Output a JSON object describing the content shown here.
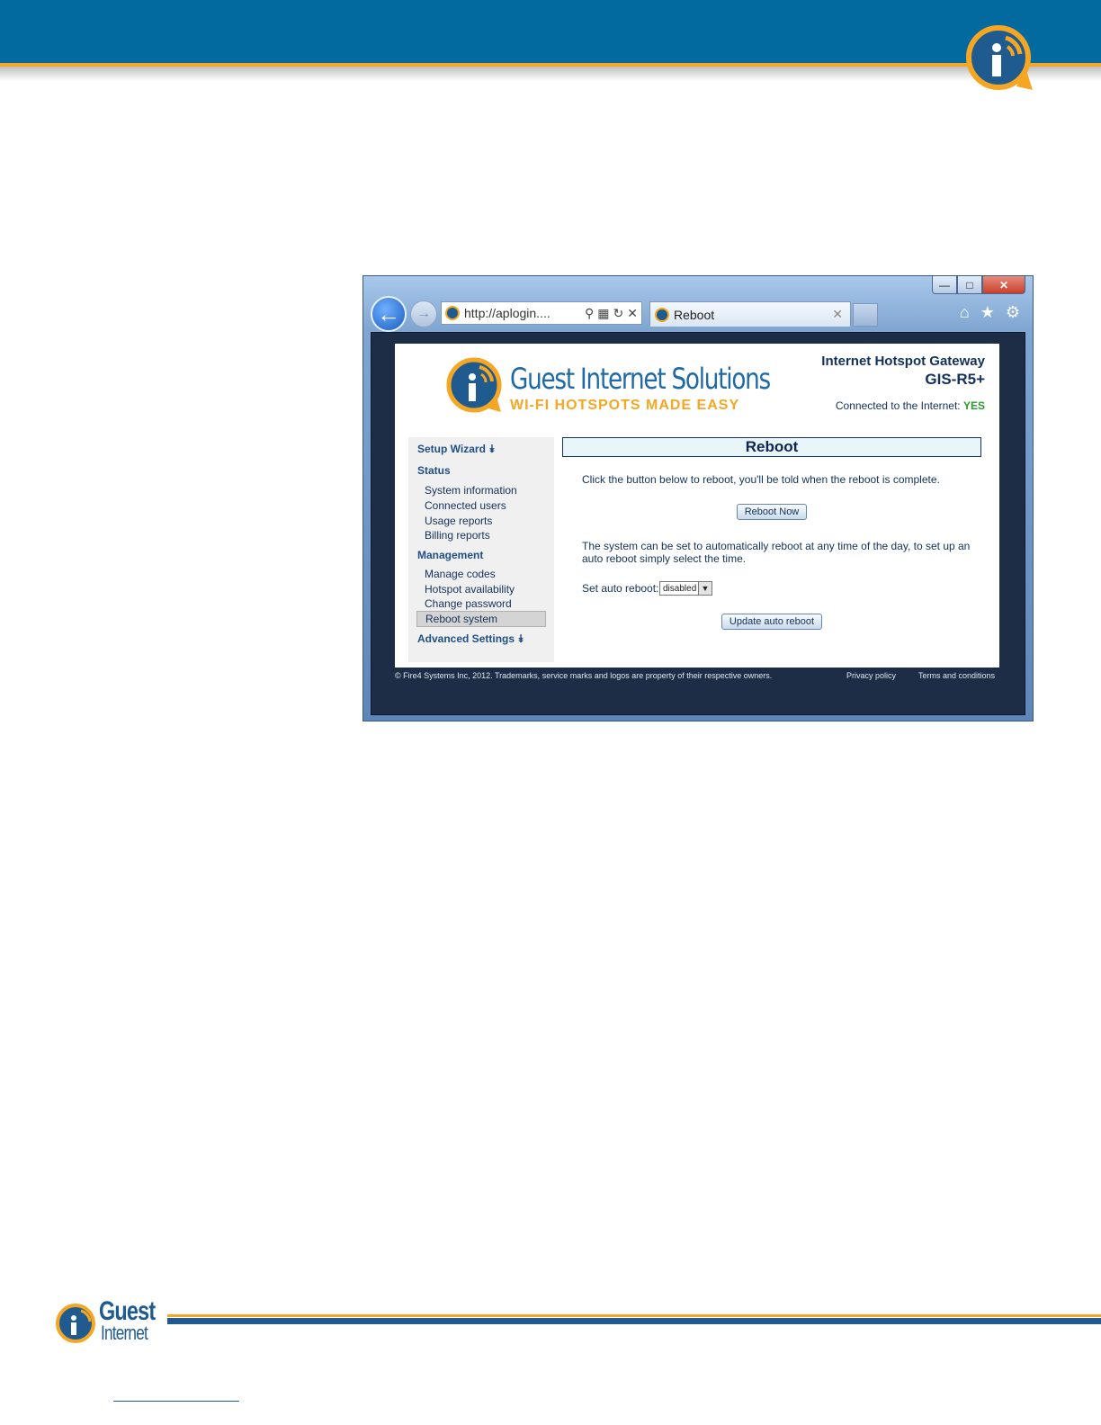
{
  "browser": {
    "address": "http://aplogin....",
    "tab_title": "Reboot",
    "window_controls": {
      "minimize": "—",
      "maximize": "□",
      "close": "✕"
    }
  },
  "site": {
    "brand_name": "Guest Internet Solutions",
    "brand_tagline": "WI-FI HOTSPOTS MADE EASY",
    "product_line1": "Internet Hotspot Gateway",
    "product_line2": "GIS-R5+",
    "connected_label": "Connected to the Internet:",
    "connected_value": "YES"
  },
  "sidebar": {
    "setup_wizard": "Setup Wizard ⯯",
    "status_head": "Status",
    "status_items": [
      "System information",
      "Connected users",
      "Usage reports",
      "Billing reports"
    ],
    "management_head": "Management",
    "management_items": [
      "Manage codes",
      "Hotspot availability",
      "Change password",
      "Reboot system"
    ],
    "advanced": "Advanced Settings ⯯"
  },
  "main": {
    "title": "Reboot",
    "instruction": "Click the button below to reboot, you'll be told when the reboot is complete.",
    "reboot_button": "Reboot Now",
    "auto_text": "The system can be set to automatically reboot at any time of the day, to set up an auto reboot simply select the time.",
    "auto_label": "Set auto reboot:",
    "auto_value": "disabled",
    "update_button": "Update auto reboot"
  },
  "footer": {
    "copyright": "© Fire4 Systems Inc, 2012. Trademarks, service marks and logos are property of their respective owners.",
    "privacy": "Privacy policy",
    "terms": "Terms and conditions"
  },
  "doc_footer": {
    "logo_line1": "Guest",
    "logo_line2": "Internet"
  },
  "colors": {
    "header_blue": "#036aa0",
    "accent_orange": "#f5a623",
    "brand_blue": "#1f6aa5"
  }
}
